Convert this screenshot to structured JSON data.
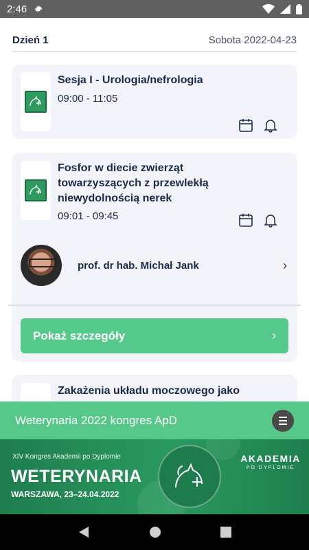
{
  "status_bar": {
    "time": "2:46"
  },
  "day": {
    "label": "Dzień 1",
    "date": "Sobota 2022-04-23"
  },
  "sessions": [
    {
      "title": "Sesja I - Urologia/nefrologia",
      "time": "09:00 - 11:05"
    },
    {
      "title_lines": [
        "Fosfor w diecie zwierząt",
        "towarzyszących z przewlekłą",
        "niewydolnością nerek"
      ],
      "time": "09:01 - 09:45",
      "speaker": "prof. dr hab. Michał Jank",
      "details_label": "Pokaż szczegóły"
    },
    {
      "title": "Zakażenia układu moczowego jako"
    }
  ],
  "congress_bar": {
    "title": "Weterynaria 2022  kongres ApD"
  },
  "banner": {
    "subtitle": "XIV Kongres Akademii po Dyplomie",
    "title": "WETERYNARIA",
    "date": "WARSZAWA, 23–24.04.2022",
    "brand_line1": "AKADEMIA",
    "brand_line2": "PO DYPLOMIE"
  },
  "colors": {
    "accent_green": "#56c98a",
    "card_bg": "#f2f4f9",
    "navy_text": "#1b2a4a"
  },
  "icons": [
    "settings-gear-icon",
    "wifi-icon",
    "signal-icon",
    "battery-icon",
    "calendar-icon",
    "bell-icon",
    "chevron-right-icon",
    "menu-icon",
    "back-icon",
    "home-icon",
    "recents-icon"
  ]
}
